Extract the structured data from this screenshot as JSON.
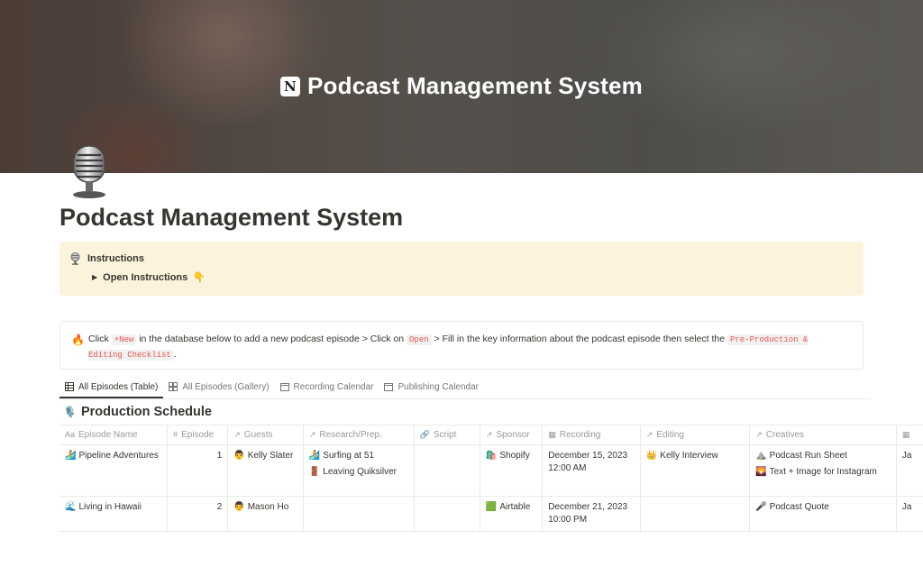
{
  "cover": {
    "title": "Podcast Management System",
    "logo_letter": "N"
  },
  "page": {
    "icon": "microphone-icon",
    "title": "Podcast Management System"
  },
  "instructions_callout": {
    "icon": "microphone-icon",
    "label": "Instructions",
    "toggle_label": "Open Instructions",
    "toggle_emoji": "👇"
  },
  "tip_callout": {
    "icon": "🔥",
    "t1": "Click ",
    "code_new": "+New",
    "t2": " in the database below to add a new podcast episode > Click on ",
    "code_open": "Open",
    "t3": " > Fill in the key information about the podcast episode then select the ",
    "code_checklist": "Pre-Production & Editing Checklist",
    "t4": "."
  },
  "tabs": [
    {
      "label": "All Episodes (Table)",
      "icon": "table-icon",
      "active": true
    },
    {
      "label": "All Episodes (Gallery)",
      "icon": "gallery-icon",
      "active": false
    },
    {
      "label": "Recording Calendar",
      "icon": "calendar-icon",
      "active": false
    },
    {
      "label": "Publishing Calendar",
      "icon": "calendar-icon",
      "active": false
    }
  ],
  "database": {
    "title": "Production Schedule",
    "title_icon": "🎙️",
    "columns": [
      {
        "label": "Episode Name",
        "icon": "Aa"
      },
      {
        "label": "Episode",
        "icon": "#"
      },
      {
        "label": "Guests",
        "icon": "↗"
      },
      {
        "label": "Research/Prep.",
        "icon": "↗"
      },
      {
        "label": "Script",
        "icon": "🔗"
      },
      {
        "label": "Sponsor",
        "icon": "↗"
      },
      {
        "label": "Recording",
        "icon": "▦"
      },
      {
        "label": "Editing",
        "icon": "↗"
      },
      {
        "label": "Creatives",
        "icon": "↗"
      },
      {
        "label": "",
        "icon": "▦"
      }
    ],
    "rows": [
      {
        "name": "Pipeline Adventures",
        "name_icon": "🏄",
        "episode": "1",
        "guest": "Kelly Slater",
        "guest_icon": "👨",
        "research": [
          {
            "icon": "🏄",
            "label": "Surfing at 51"
          },
          {
            "icon": "🚪",
            "label": "Leaving Quiksilver"
          }
        ],
        "script": "",
        "sponsor": "Shopify",
        "sponsor_icon": "🛍️",
        "recording": "December 15, 2023 12:00 AM",
        "editing": "Kelly Interview",
        "editing_icon": "👑",
        "creatives": [
          {
            "icon": "⛰️",
            "label": "Podcast Run Sheet"
          },
          {
            "icon": "🌄",
            "label": "Text + Image for Instagram"
          }
        ],
        "publish": "Ja"
      },
      {
        "name": "Living in Hawaii",
        "name_icon": "🌊",
        "episode": "2",
        "guest": "Mason Ho",
        "guest_icon": "👨",
        "research": [],
        "script": "",
        "sponsor": "Airtable",
        "sponsor_icon": "🟩",
        "recording": "December 21, 2023 10:00 PM",
        "editing": "",
        "editing_icon": "",
        "creatives": [
          {
            "icon": "🎤",
            "label": "Podcast Quote"
          }
        ],
        "publish": "Ja"
      }
    ]
  }
}
